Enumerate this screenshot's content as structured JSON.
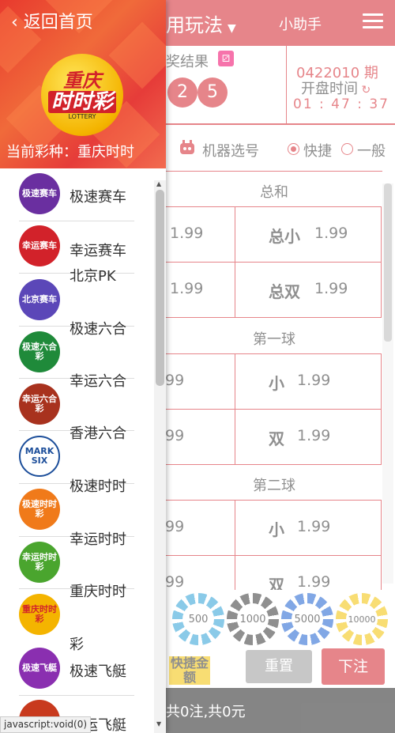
{
  "main": {
    "title": "用玩法",
    "helper": "小助手",
    "results_label": "奖结果",
    "balls": [
      "2",
      "5"
    ],
    "period": "0422010 期",
    "open_time_label": "开盘时间",
    "countdown": "01 : 47 : 37",
    "robot_label": "机器选号",
    "mode_fast": "快捷",
    "mode_normal": "一般",
    "sections": [
      {
        "title": "总和",
        "cells": [
          {
            "key": "",
            "val": "1.99"
          },
          {
            "key": "总小",
            "val": "1.99"
          },
          {
            "key": "",
            "val": "1.99"
          },
          {
            "key": "总双",
            "val": "1.99"
          }
        ]
      },
      {
        "title": "第一球",
        "cells": [
          {
            "key": "",
            "val": "99"
          },
          {
            "key": "小",
            "val": "1.99"
          },
          {
            "key": "",
            "val": "99"
          },
          {
            "key": "双",
            "val": "1.99"
          }
        ]
      },
      {
        "title": "第二球",
        "cells": [
          {
            "key": "",
            "val": "99"
          },
          {
            "key": "小",
            "val": "1.99"
          },
          {
            "key": "",
            "val": "99"
          },
          {
            "key": "双",
            "val": "1.99"
          }
        ]
      }
    ],
    "chips": [
      "500",
      "1000",
      "5000",
      "10000"
    ],
    "quick_amount": "快捷金额",
    "reset": "重置",
    "bet": "下注",
    "footer_summary": "共0注,共0元"
  },
  "drawer": {
    "back_label": "返回首页",
    "logo_line1": "重庆",
    "logo_line2": "时时彩",
    "logo_line3": "LOTTERY",
    "current_label": "当前彩种：重庆时时",
    "items": [
      {
        "name": "极速赛车",
        "icon": "极速赛车",
        "color": "#6a2fa0"
      },
      {
        "name": "幸运赛车",
        "icon": "幸运赛车",
        "color": "#d2222a"
      },
      {
        "name": "北京PK",
        "icon": "北京赛车",
        "color": "#5b47b8"
      },
      {
        "name": "极速六合",
        "icon": "极速六合彩",
        "color": "#1f8a3a"
      },
      {
        "name": "幸运六合",
        "icon": "幸运六合彩",
        "color": "#a8321e"
      },
      {
        "name": "香港六合",
        "icon": "MARK SIX",
        "color": "#1c4e9a"
      },
      {
        "name": "极速时时",
        "icon": "极速时时彩",
        "color": "#f07a1a"
      },
      {
        "name": "幸运时时",
        "icon": "幸运时时彩",
        "color": "#4aa52e"
      },
      {
        "name": "重庆时时",
        "icon": "重庆时时彩",
        "color": "#f4b400"
      },
      {
        "name": "彩",
        "icon": "",
        "color": ""
      },
      {
        "name": "极速飞艇",
        "icon": "极速飞艇",
        "color": "#8a2fb0"
      },
      {
        "name": "幸运飞艇",
        "icon": "",
        "color": "#c83a1e"
      }
    ],
    "status_url": "javascript:void(0)"
  }
}
